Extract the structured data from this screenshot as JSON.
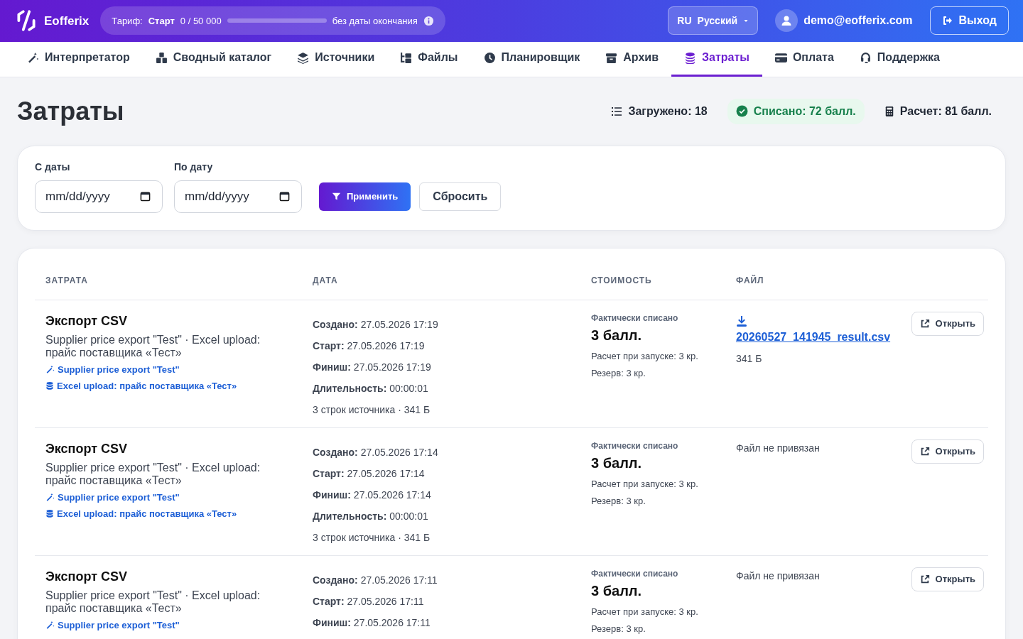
{
  "brand": {
    "name": "Eofferix"
  },
  "plan": {
    "label": "Тариф:",
    "name": "Старт",
    "usage": "0 / 50 000",
    "level": 0,
    "expiry": "без даты окончания"
  },
  "language": {
    "code": "RU",
    "name": "Русский"
  },
  "user": {
    "email": "demo@eofferix.com"
  },
  "logout": "Выход",
  "nav": [
    {
      "label": "Интерпретатор",
      "selected": false
    },
    {
      "label": "Сводный каталог",
      "selected": false
    },
    {
      "label": "Источники",
      "selected": false
    },
    {
      "label": "Файлы",
      "selected": false
    },
    {
      "label": "Планировщик",
      "selected": false
    },
    {
      "label": "Архив",
      "selected": false
    },
    {
      "label": "Затраты",
      "selected": true
    },
    {
      "label": "Оплата",
      "selected": false
    },
    {
      "label": "Поддержка",
      "selected": false
    }
  ],
  "page_title": "Затраты",
  "stats": [
    {
      "kind": "list",
      "text": "Загружено: 18"
    },
    {
      "kind": "success",
      "text": "Списано: 72 балл."
    },
    {
      "kind": "calc",
      "text": "Расчет: 81 балл."
    }
  ],
  "filters": {
    "from": {
      "label": "С даты",
      "placeholder": "mm/dd/yyyy"
    },
    "to": {
      "label": "По дату",
      "placeholder": "mm/dd/yyyy"
    },
    "apply": "Применить",
    "reset": "Сбросить"
  },
  "table": {
    "columns": [
      "ЗАТРАТА",
      "ДАТА",
      "СТОИМОСТЬ",
      "ФАЙЛ"
    ],
    "rows": [
      {
        "title": "Экспорт CSV",
        "description": "Supplier price export \"Test\" · Excel upload: прайс поставщика «Тест»",
        "links": [
          {
            "kind": "interpreter",
            "text": "Supplier price export \"Test\""
          },
          {
            "kind": "source",
            "text": "Excel upload: прайс поставщика «Тест»"
          }
        ],
        "dates": [
          {
            "label": "Создано:",
            "value": "27.05.2026 17:19"
          },
          {
            "label": "Старт:",
            "value": "27.05.2026 17:19"
          },
          {
            "label": "Финиш:",
            "value": "27.05.2026 17:19"
          },
          {
            "label": "Длительность:",
            "value": "00:00:01"
          }
        ],
        "summary": "3 строк источника · 341 Б",
        "cost_label": "Фактически списано",
        "cost": "3 балл.",
        "cost_notes": [
          "Расчет при запуске: 3 кр.",
          "Резерв: 3 кр."
        ],
        "file": {
          "name": "20260527_141945_result.csv",
          "size": "341 Б"
        },
        "open": "Открыть"
      },
      {
        "title": "Экспорт CSV",
        "description": "Supplier price export \"Test\" · Excel upload: прайс поставщика «Тест»",
        "links": [
          {
            "kind": "interpreter",
            "text": "Supplier price export \"Test\""
          },
          {
            "kind": "source",
            "text": "Excel upload: прайс поставщика «Тест»"
          }
        ],
        "dates": [
          {
            "label": "Создано:",
            "value": "27.05.2026 17:14"
          },
          {
            "label": "Старт:",
            "value": "27.05.2026 17:14"
          },
          {
            "label": "Финиш:",
            "value": "27.05.2026 17:14"
          },
          {
            "label": "Длительность:",
            "value": "00:00:01"
          }
        ],
        "summary": "3 строк источника · 341 Б",
        "cost_label": "Фактически списано",
        "cost": "3 балл.",
        "cost_notes": [
          "Расчет при запуске: 3 кр.",
          "Резерв: 3 кр."
        ],
        "no_file": "Файл не привязан",
        "open": "Открыть"
      },
      {
        "title": "Экспорт CSV",
        "description": "Supplier price export \"Test\" · Excel upload: прайс поставщика «Тест»",
        "links": [
          {
            "kind": "interpreter",
            "text": "Supplier price export \"Test\""
          }
        ],
        "dates": [
          {
            "label": "Создано:",
            "value": "27.05.2026 17:11"
          },
          {
            "label": "Старт:",
            "value": "27.05.2026 17:11"
          },
          {
            "label": "Финиш:",
            "value": "27.05.2026 17:11"
          }
        ],
        "cost_label": "Фактически списано",
        "cost": "3 балл.",
        "cost_notes": [
          "Расчет при запуске: 3 кр.",
          "Резерв: 3 кр."
        ],
        "no_file": "Файл не привязан",
        "open": "Открыть"
      }
    ]
  }
}
